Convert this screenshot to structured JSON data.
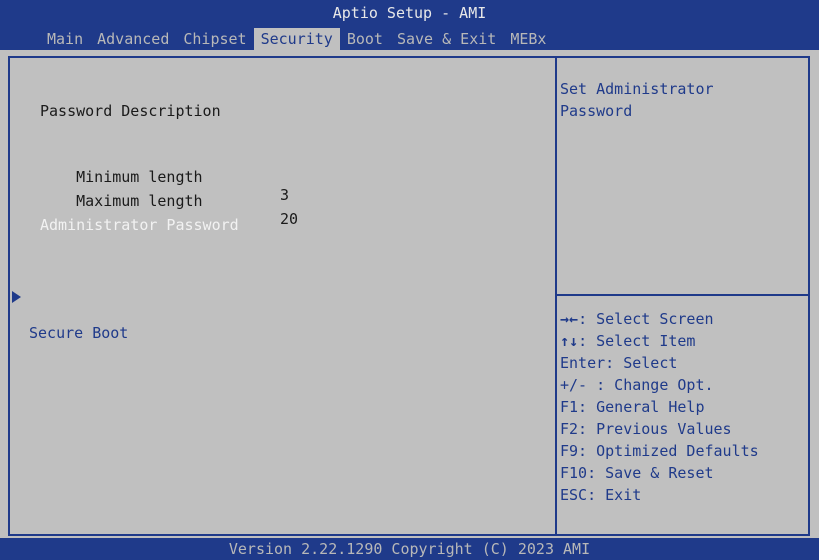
{
  "header": {
    "title": "Aptio Setup - AMI",
    "tabs": [
      "Main",
      "Advanced",
      "Chipset",
      "Security",
      "Boot",
      "Save & Exit",
      "MEBx"
    ],
    "active_tab": "Security"
  },
  "main": {
    "password_description": "Password Description",
    "min_label": "Minimum length",
    "min_value": "3",
    "max_label": "Maximum length",
    "max_value": "20",
    "admin_password": "Administrator Password",
    "secure_boot": "Secure Boot"
  },
  "help": {
    "line1": "Set Administrator",
    "line2": "Password"
  },
  "keys": [
    {
      "key": "→←",
      "text": ": Select Screen"
    },
    {
      "key": "↑↓",
      "text": ": Select Item"
    },
    {
      "key": "",
      "text": "Enter: Select"
    },
    {
      "key": "",
      "text": "+/- : Change Opt."
    },
    {
      "key": "",
      "text": "F1: General Help"
    },
    {
      "key": "",
      "text": "F2: Previous Values"
    },
    {
      "key": "",
      "text": "F9: Optimized Defaults"
    },
    {
      "key": "",
      "text": "F10: Save & Reset"
    },
    {
      "key": "",
      "text": "ESC: Exit"
    }
  ],
  "footer": {
    "version": "Version 2.22.1290 Copyright (C) 2023 AMI"
  },
  "colors": {
    "background": "#c0c0c0",
    "bar": "#1f3a8a",
    "help_text": "#1f3a8a"
  }
}
